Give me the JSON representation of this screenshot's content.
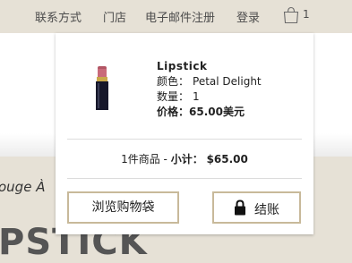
{
  "nav": {
    "contact": "联系方式",
    "store": "门店",
    "email_signup": "电子邮件注册",
    "login": "登录",
    "bag_icon": "shopping-bag-icon",
    "bag_count": "1"
  },
  "page": {
    "subtitle_fragment": "ouge À",
    "title_fragment": "PSTICK"
  },
  "mini_cart": {
    "item": {
      "image_icon": "lipstick-icon",
      "name": "Lipstick",
      "color_label": "颜色：",
      "color_value": "Petal Delight",
      "qty_label": "数量：",
      "qty_value": "1",
      "price_label": "价格：",
      "price_value": "65.00美元"
    },
    "summary": {
      "count_text": "1件商品 - ",
      "subtotal_label": "小计：",
      "subtotal_value": "$65.00"
    },
    "browse_button": "浏览购物袋",
    "checkout_button": "结账",
    "checkout_icon": "lock-icon"
  },
  "colors": {
    "page_bg": "#e6e1d6",
    "button_border": "#c8b99a",
    "lipstick": "#c96a7a"
  }
}
